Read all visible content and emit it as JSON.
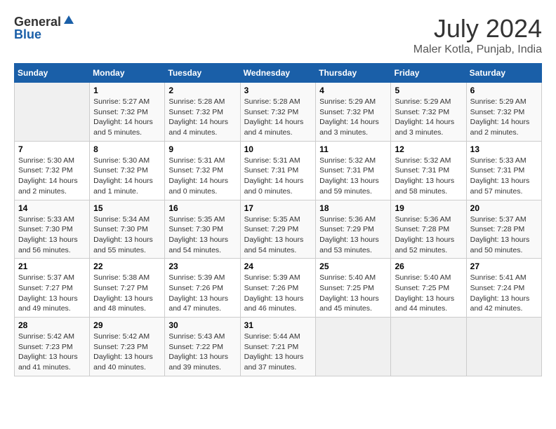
{
  "header": {
    "logo_general": "General",
    "logo_blue": "Blue",
    "month": "July 2024",
    "location": "Maler Kotla, Punjab, India"
  },
  "days_of_week": [
    "Sunday",
    "Monday",
    "Tuesday",
    "Wednesday",
    "Thursday",
    "Friday",
    "Saturday"
  ],
  "weeks": [
    [
      {
        "day": "",
        "info": ""
      },
      {
        "day": "1",
        "info": "Sunrise: 5:27 AM\nSunset: 7:32 PM\nDaylight: 14 hours\nand 5 minutes."
      },
      {
        "day": "2",
        "info": "Sunrise: 5:28 AM\nSunset: 7:32 PM\nDaylight: 14 hours\nand 4 minutes."
      },
      {
        "day": "3",
        "info": "Sunrise: 5:28 AM\nSunset: 7:32 PM\nDaylight: 14 hours\nand 4 minutes."
      },
      {
        "day": "4",
        "info": "Sunrise: 5:29 AM\nSunset: 7:32 PM\nDaylight: 14 hours\nand 3 minutes."
      },
      {
        "day": "5",
        "info": "Sunrise: 5:29 AM\nSunset: 7:32 PM\nDaylight: 14 hours\nand 3 minutes."
      },
      {
        "day": "6",
        "info": "Sunrise: 5:29 AM\nSunset: 7:32 PM\nDaylight: 14 hours\nand 2 minutes."
      }
    ],
    [
      {
        "day": "7",
        "info": "Sunrise: 5:30 AM\nSunset: 7:32 PM\nDaylight: 14 hours\nand 2 minutes."
      },
      {
        "day": "8",
        "info": "Sunrise: 5:30 AM\nSunset: 7:32 PM\nDaylight: 14 hours\nand 1 minute."
      },
      {
        "day": "9",
        "info": "Sunrise: 5:31 AM\nSunset: 7:32 PM\nDaylight: 14 hours\nand 0 minutes."
      },
      {
        "day": "10",
        "info": "Sunrise: 5:31 AM\nSunset: 7:31 PM\nDaylight: 14 hours\nand 0 minutes."
      },
      {
        "day": "11",
        "info": "Sunrise: 5:32 AM\nSunset: 7:31 PM\nDaylight: 13 hours\nand 59 minutes."
      },
      {
        "day": "12",
        "info": "Sunrise: 5:32 AM\nSunset: 7:31 PM\nDaylight: 13 hours\nand 58 minutes."
      },
      {
        "day": "13",
        "info": "Sunrise: 5:33 AM\nSunset: 7:31 PM\nDaylight: 13 hours\nand 57 minutes."
      }
    ],
    [
      {
        "day": "14",
        "info": "Sunrise: 5:33 AM\nSunset: 7:30 PM\nDaylight: 13 hours\nand 56 minutes."
      },
      {
        "day": "15",
        "info": "Sunrise: 5:34 AM\nSunset: 7:30 PM\nDaylight: 13 hours\nand 55 minutes."
      },
      {
        "day": "16",
        "info": "Sunrise: 5:35 AM\nSunset: 7:30 PM\nDaylight: 13 hours\nand 54 minutes."
      },
      {
        "day": "17",
        "info": "Sunrise: 5:35 AM\nSunset: 7:29 PM\nDaylight: 13 hours\nand 54 minutes."
      },
      {
        "day": "18",
        "info": "Sunrise: 5:36 AM\nSunset: 7:29 PM\nDaylight: 13 hours\nand 53 minutes."
      },
      {
        "day": "19",
        "info": "Sunrise: 5:36 AM\nSunset: 7:28 PM\nDaylight: 13 hours\nand 52 minutes."
      },
      {
        "day": "20",
        "info": "Sunrise: 5:37 AM\nSunset: 7:28 PM\nDaylight: 13 hours\nand 50 minutes."
      }
    ],
    [
      {
        "day": "21",
        "info": "Sunrise: 5:37 AM\nSunset: 7:27 PM\nDaylight: 13 hours\nand 49 minutes."
      },
      {
        "day": "22",
        "info": "Sunrise: 5:38 AM\nSunset: 7:27 PM\nDaylight: 13 hours\nand 48 minutes."
      },
      {
        "day": "23",
        "info": "Sunrise: 5:39 AM\nSunset: 7:26 PM\nDaylight: 13 hours\nand 47 minutes."
      },
      {
        "day": "24",
        "info": "Sunrise: 5:39 AM\nSunset: 7:26 PM\nDaylight: 13 hours\nand 46 minutes."
      },
      {
        "day": "25",
        "info": "Sunrise: 5:40 AM\nSunset: 7:25 PM\nDaylight: 13 hours\nand 45 minutes."
      },
      {
        "day": "26",
        "info": "Sunrise: 5:40 AM\nSunset: 7:25 PM\nDaylight: 13 hours\nand 44 minutes."
      },
      {
        "day": "27",
        "info": "Sunrise: 5:41 AM\nSunset: 7:24 PM\nDaylight: 13 hours\nand 42 minutes."
      }
    ],
    [
      {
        "day": "28",
        "info": "Sunrise: 5:42 AM\nSunset: 7:23 PM\nDaylight: 13 hours\nand 41 minutes."
      },
      {
        "day": "29",
        "info": "Sunrise: 5:42 AM\nSunset: 7:23 PM\nDaylight: 13 hours\nand 40 minutes."
      },
      {
        "day": "30",
        "info": "Sunrise: 5:43 AM\nSunset: 7:22 PM\nDaylight: 13 hours\nand 39 minutes."
      },
      {
        "day": "31",
        "info": "Sunrise: 5:44 AM\nSunset: 7:21 PM\nDaylight: 13 hours\nand 37 minutes."
      },
      {
        "day": "",
        "info": ""
      },
      {
        "day": "",
        "info": ""
      },
      {
        "day": "",
        "info": ""
      }
    ]
  ]
}
